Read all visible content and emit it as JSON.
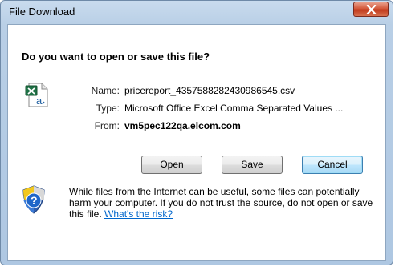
{
  "window": {
    "title": "File Download"
  },
  "prompt": {
    "question": "Do you want to open or save this file?"
  },
  "file": {
    "icon": "excel-csv-file-icon",
    "name_label": "Name:",
    "name_value": "pricereport_4357588282430986545.csv",
    "type_label": "Type:",
    "type_value": "Microsoft Office Excel Comma Separated Values ...",
    "from_label": "From:",
    "from_value": "vm5pec122qa.elcom.com"
  },
  "buttons": {
    "open": "Open",
    "save": "Save",
    "cancel": "Cancel"
  },
  "warning": {
    "icon": "security-shield-icon",
    "text": "While files from the Internet can be useful, some files can potentially harm your computer. If you do not trust the source, do not open or save this file. ",
    "link": "What's the risk?"
  },
  "colors": {
    "accent": "#3c7fb1",
    "close": "#c13a1c",
    "link": "#0066cc"
  }
}
